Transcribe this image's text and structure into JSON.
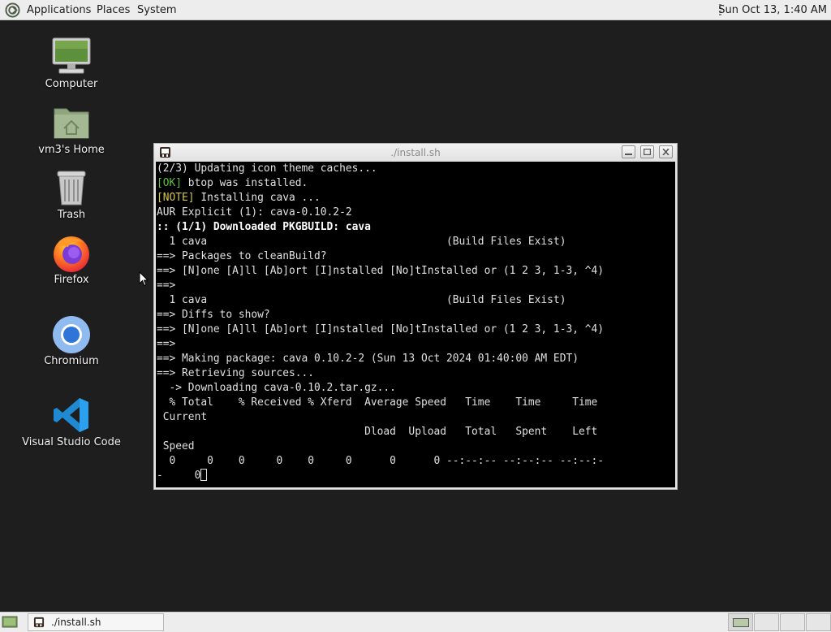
{
  "top_panel": {
    "menus": [
      "Applications",
      "Places",
      "System"
    ],
    "clock": "Sun Oct 13,  1:40 AM"
  },
  "desktop_icons": [
    {
      "label": "Computer",
      "icon": "computer-icon"
    },
    {
      "label": "vm3's Home",
      "icon": "home-folder-icon"
    },
    {
      "label": "Trash",
      "icon": "trash-icon"
    },
    {
      "label": "Firefox",
      "icon": "firefox-icon"
    },
    {
      "label": "Chromium",
      "icon": "chromium-icon"
    },
    {
      "label": "Visual Studio Code",
      "icon": "vscode-icon"
    }
  ],
  "terminal": {
    "title": "./install.sh",
    "lines": [
      [
        {
          "t": "(2/3) Updating icon theme caches..."
        }
      ],
      [
        {
          "t": "[OK]",
          "c": "green"
        },
        {
          "t": " btop was installed."
        }
      ],
      [
        {
          "t": "[NOTE]",
          "c": "yellow"
        },
        {
          "t": " Installing cava ..."
        }
      ],
      [
        {
          "t": "AUR Explicit (1): cava-0.10.2-2"
        }
      ],
      [
        {
          "t": ":: (1/1) Downloaded PKGBUILD: cava",
          "c": "bold"
        }
      ],
      [
        {
          "t": "  1 cava                                      (Build Files Exist)"
        }
      ],
      [
        {
          "t": "==> Packages to cleanBuild?"
        }
      ],
      [
        {
          "t": "==> [N]one [A]ll [Ab]ort [I]nstalled [No]tInstalled or (1 2 3, 1-3, ^4)"
        }
      ],
      [
        {
          "t": "==>"
        }
      ],
      [
        {
          "t": "  1 cava                                      (Build Files Exist)"
        }
      ],
      [
        {
          "t": "==> Diffs to show?"
        }
      ],
      [
        {
          "t": "==> [N]one [A]ll [Ab]ort [I]nstalled [No]tInstalled or (1 2 3, 1-3, ^4)"
        }
      ],
      [
        {
          "t": "==>"
        }
      ],
      [
        {
          "t": "==> Making package: cava 0.10.2-2 (Sun 13 Oct 2024 01:40:00 AM EDT)"
        }
      ],
      [
        {
          "t": "==> Retrieving sources..."
        }
      ],
      [
        {
          "t": "  -> Downloading cava-0.10.2.tar.gz..."
        }
      ],
      [
        {
          "t": "  % Total    % Received % Xferd  Average Speed   Time    Time     Time"
        }
      ],
      [
        {
          "t": " Current"
        }
      ],
      [
        {
          "t": "                                 Dload  Upload   Total   Spent    Left"
        }
      ],
      [
        {
          "t": " Speed"
        }
      ],
      [
        {
          "t": "  0     0    0     0    0     0      0      0 --:--:-- --:--:-- --:--:-"
        }
      ],
      [
        {
          "t": "-     0"
        }
      ]
    ]
  },
  "taskbar": {
    "task_label": "./install.sh"
  }
}
